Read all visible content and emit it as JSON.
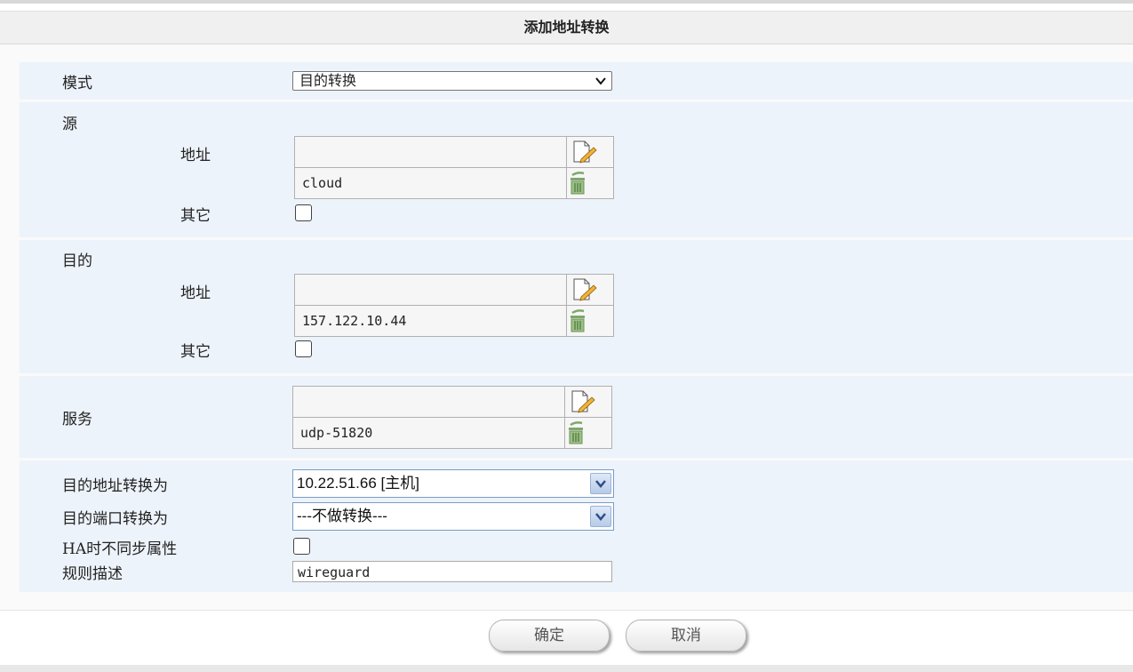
{
  "dialog": {
    "title": "添加地址转换"
  },
  "mode": {
    "label": "模式",
    "value": "目的转换"
  },
  "source": {
    "label": "源",
    "address_label": "地址",
    "address_input": "",
    "address_value": "cloud",
    "other_label": "其它"
  },
  "destination": {
    "label": "目的",
    "address_label": "地址",
    "address_input": "",
    "address_value": "157.122.10.44",
    "other_label": "其它"
  },
  "service": {
    "label": "服务",
    "input": "",
    "value": "udp-51820"
  },
  "translate": {
    "dest_addr_label": "目的地址转换为",
    "dest_addr_value": "10.22.51.66 [主机]",
    "dest_port_label": "目的端口转换为",
    "dest_port_value": "---不做转换---",
    "ha_label": "HA时不同步属性",
    "desc_label": "规则描述",
    "desc_value": "wireguard"
  },
  "buttons": {
    "ok": "确定",
    "cancel": "取消"
  },
  "icons": {
    "edit": "edit-pencil-icon",
    "delete": "trash-icon",
    "dropdown": "chevron-down-icon"
  },
  "colors": {
    "row_bg": "#edf3fa",
    "trash_green": "#7ea86a"
  }
}
